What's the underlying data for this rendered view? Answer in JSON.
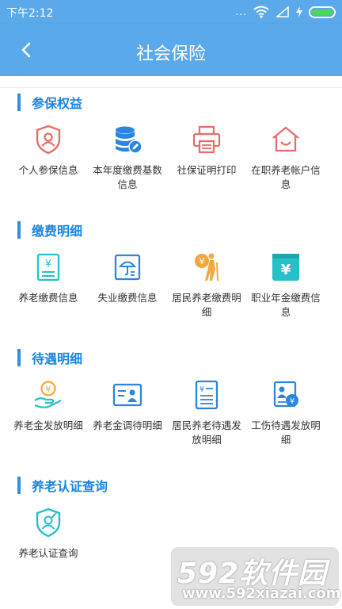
{
  "status": {
    "time": "下午2:12",
    "dots": "..."
  },
  "header": {
    "title": "社会保险"
  },
  "sections": [
    {
      "title": "参保权益",
      "items": [
        {
          "label": "个人参保信息",
          "icon": "shield-person-icon"
        },
        {
          "label": "本年度缴费基数信息",
          "icon": "database-edit-icon"
        },
        {
          "label": "社保证明打印",
          "icon": "printer-icon"
        },
        {
          "label": "在职养老帐户信息",
          "icon": "house-icon"
        }
      ]
    },
    {
      "title": "缴费明细",
      "items": [
        {
          "label": "养老缴费信息",
          "icon": "yuan-document-icon"
        },
        {
          "label": "失业缴费信息",
          "icon": "umbrella-card-icon"
        },
        {
          "label": "居民养老缴费明细",
          "icon": "elder-coin-icon"
        },
        {
          "label": "职业年金缴费信息",
          "icon": "yuan-wallet-icon"
        }
      ]
    },
    {
      "title": "待遇明细",
      "items": [
        {
          "label": "养老金发放明细",
          "icon": "hand-coin-icon"
        },
        {
          "label": "养老金调待明细",
          "icon": "id-card-icon"
        },
        {
          "label": "居民养老待遇发放明细",
          "icon": "yuan-list-icon"
        },
        {
          "label": "工伤待遇发放明细",
          "icon": "person-yuan-card-icon"
        }
      ]
    },
    {
      "title": "养老认证查询",
      "items": [
        {
          "label": "养老认证查询",
          "icon": "shield-face-icon"
        }
      ]
    }
  ],
  "watermark": {
    "brand": "592软件园",
    "url": "www.592xiazai.com"
  },
  "colors": {
    "header": "#5aa9ea",
    "accent": "#2f8de4",
    "red": "#e96b6b",
    "blue": "#2a86e0",
    "orange": "#f2a83a",
    "teal": "#26c0c8"
  }
}
